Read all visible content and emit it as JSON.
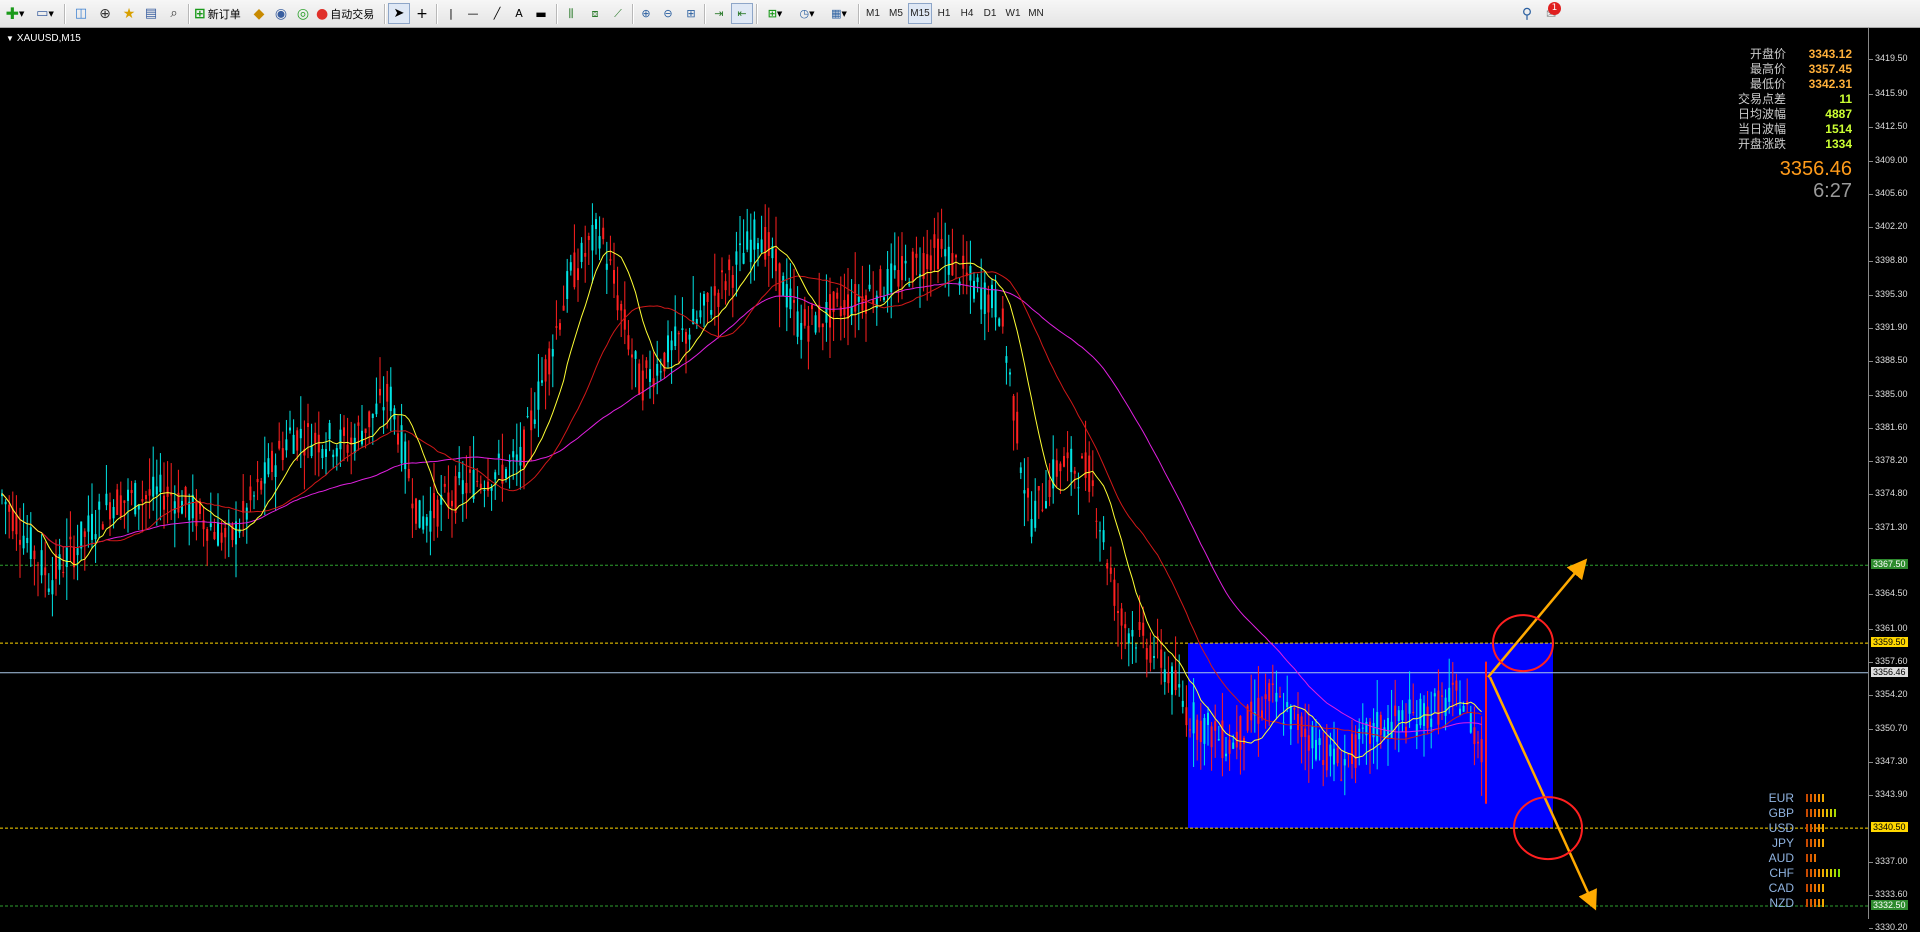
{
  "toolbar": {
    "new_order_label": "新订单",
    "auto_trade_label": "自动交易",
    "timeframes": [
      "M1",
      "M5",
      "M15",
      "H1",
      "H4",
      "D1",
      "W1",
      "MN"
    ],
    "active_timeframe": "M15",
    "notification_count": "1"
  },
  "chart": {
    "symbol_label": "XAUUSD,M15",
    "current_price": "3356.46",
    "countdown": "6:27",
    "info_panel": [
      {
        "label": "开盘价",
        "value": "3343.12",
        "color": "#ffb03a"
      },
      {
        "label": "最高价",
        "value": "3357.45",
        "color": "#ffb03a"
      },
      {
        "label": "最低价",
        "value": "3342.31",
        "color": "#ffb03a"
      },
      {
        "label": "交易点差",
        "value": "11",
        "color": "#ccff33"
      },
      {
        "label": "日均波幅",
        "value": "4887",
        "color": "#ccff33"
      },
      {
        "label": "当日波幅",
        "value": "1514",
        "color": "#ccff33"
      },
      {
        "label": "开盘涨跌",
        "value": "1334",
        "color": "#ccff33"
      }
    ],
    "price_axis": {
      "labels": [
        "3419.50",
        "3415.90",
        "3412.50",
        "3409.00",
        "3405.60",
        "3402.20",
        "3398.80",
        "3395.30",
        "3391.90",
        "3388.50",
        "3385.00",
        "3381.60",
        "3378.20",
        "3374.80",
        "3371.30",
        "3364.50",
        "3361.00",
        "3357.60",
        "3354.20",
        "3350.70",
        "3347.30",
        "3343.90",
        "3337.00",
        "3333.60",
        "3330.20"
      ],
      "levels": [
        {
          "price": "3367.50",
          "bg": "#2e8b2e",
          "fg": "#ffffff"
        },
        {
          "price": "3359.50",
          "bg": "#ffd700",
          "fg": "#000000"
        },
        {
          "price": "3356.46",
          "bg": "#dddddd",
          "fg": "#000000"
        },
        {
          "price": "3340.50",
          "bg": "#ffd700",
          "fg": "#000000"
        },
        {
          "price": "3332.50",
          "bg": "#2e8b2e",
          "fg": "#ffffff"
        }
      ]
    },
    "currency_strength": [
      {
        "name": "EUR",
        "bars": 5
      },
      {
        "name": "GBP",
        "bars": 8
      },
      {
        "name": "USD",
        "bars": 5
      },
      {
        "name": "JPY",
        "bars": 5
      },
      {
        "name": "AUD",
        "bars": 3
      },
      {
        "name": "CHF",
        "bars": 9
      },
      {
        "name": "CAD",
        "bars": 5
      },
      {
        "name": "NZD",
        "bars": 5
      }
    ],
    "colors": {
      "bull_candle": "#00e5e5",
      "bear_candle": "#ff2020",
      "ma_fast": "#ffff33",
      "ma_mid": "#d01818",
      "ma_slow": "#e020e0",
      "range_box": "#0000ff",
      "arrows": "#ffaa00",
      "circles": "#ff2020"
    }
  }
}
